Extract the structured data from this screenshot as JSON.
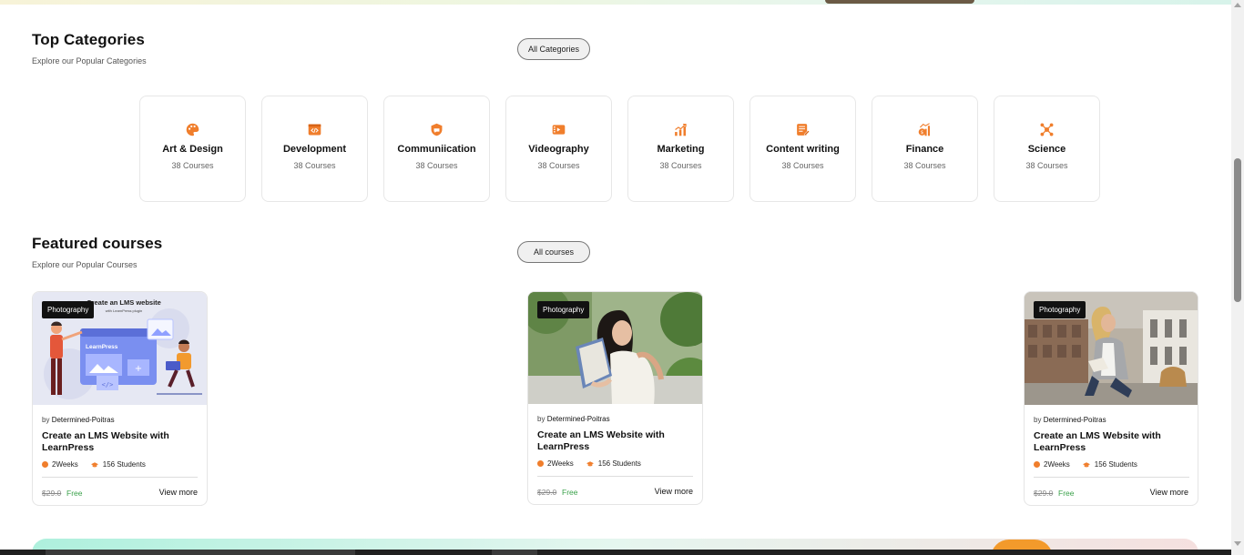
{
  "categories_section": {
    "title": "Top Categories",
    "subtitle": "Explore our Popular Categories",
    "all_button": "All Categories",
    "items": [
      {
        "name": "Art & Design",
        "count": "38 Courses",
        "icon": "palette-icon"
      },
      {
        "name": "Development",
        "count": "38 Courses",
        "icon": "code-icon"
      },
      {
        "name": "Communiication",
        "count": "38 Courses",
        "icon": "shield-chat-icon"
      },
      {
        "name": "Videography",
        "count": "38 Courses",
        "icon": "video-icon"
      },
      {
        "name": "Marketing",
        "count": "38 Courses",
        "icon": "growth-chart-icon"
      },
      {
        "name": "Content writing",
        "count": "38 Courses",
        "icon": "document-pen-icon"
      },
      {
        "name": "Finance",
        "count": "38 Courses",
        "icon": "money-chart-icon"
      },
      {
        "name": "Science",
        "count": "38 Courses",
        "icon": "molecule-icon"
      }
    ]
  },
  "featured_section": {
    "title": "Featured courses",
    "subtitle": "Explore our Popular Courses",
    "all_button": "All courses",
    "courses": [
      {
        "tag": "Photography",
        "by_prefix": "by",
        "author": "Determined-Poitras",
        "title": "Create an LMS Website with LearnPress",
        "duration": "2Weeks",
        "students": "156 Students",
        "old_price": "$29.0",
        "price": "Free",
        "view_more": "View more",
        "thumb_text": "Create an LMS website",
        "thumb_sub": "with LearnPress plugin",
        "thumb_logo": "LearnPress"
      },
      {
        "tag": "Photography",
        "by_prefix": "by",
        "author": "Determined-Poitras",
        "title": "Create an LMS Website with LearnPress",
        "duration": "2Weeks",
        "students": "156 Students",
        "old_price": "$29.0",
        "price": "Free",
        "view_more": "View more"
      },
      {
        "tag": "Photography",
        "by_prefix": "by",
        "author": "Determined-Poitras",
        "title": "Create an LMS Website with LearnPress",
        "duration": "2Weeks",
        "students": "156 Students",
        "old_price": "$29.0",
        "price": "Free",
        "view_more": "View more"
      }
    ]
  },
  "colors": {
    "accent": "#f07e2c",
    "free": "#3aa14a"
  }
}
